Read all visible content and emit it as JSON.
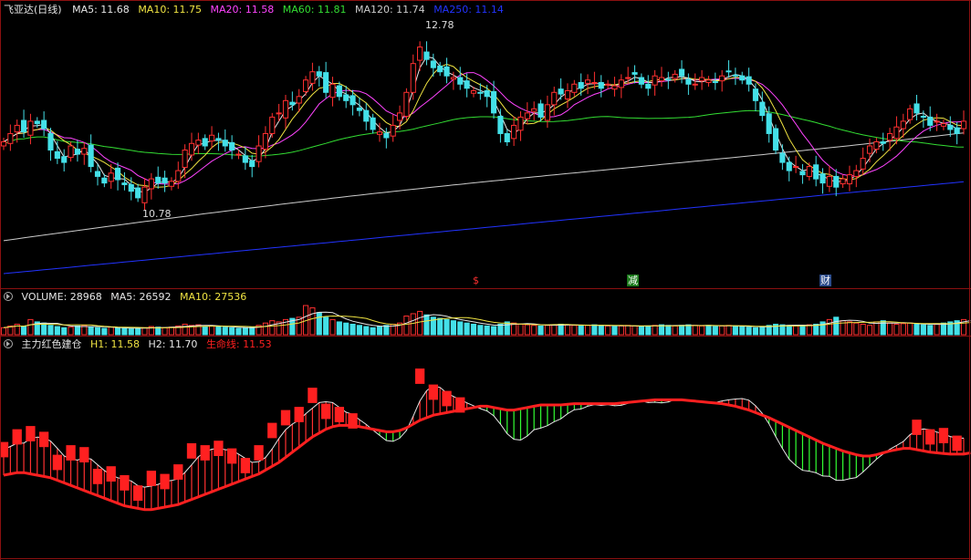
{
  "main_legend": {
    "title": "飞亚达(日线)",
    "items": [
      {
        "label": "MA5: 11.68",
        "color": "#e6e6e6"
      },
      {
        "label": "MA10: 11.75",
        "color": "#f0e442"
      },
      {
        "label": "MA20: 11.58",
        "color": "#ff44ff"
      },
      {
        "label": "MA60: 11.81",
        "color": "#33dd33"
      },
      {
        "label": "MA120: 11.74",
        "color": "#cccccc"
      },
      {
        "label": "MA250: 11.14",
        "color": "#2233ff"
      }
    ]
  },
  "volume_legend": {
    "items": [
      {
        "label": "VOLUME: 28968",
        "color": "#e6e6e6"
      },
      {
        "label": "MA5: 26592",
        "color": "#e6e6e6"
      },
      {
        "label": "MA10: 27536",
        "color": "#f0e442"
      }
    ]
  },
  "indicator_legend": {
    "items": [
      {
        "label": "主力红色建仓",
        "color": "#e6e6e6"
      },
      {
        "label": "H1: 11.58",
        "color": "#f0e442"
      },
      {
        "label": "H2: 11.70",
        "color": "#e6e6e6"
      },
      {
        "label": "生命线: 11.53",
        "color": "#ff2020"
      }
    ]
  },
  "events": [
    {
      "label": "$",
      "color": "#ff3030",
      "bg": "#000000"
    },
    {
      "label": "减",
      "color": "#ffffff",
      "bg": "#1a7a1a"
    },
    {
      "label": "财",
      "color": "#ffffff",
      "bg": "#2a4a8a"
    }
  ],
  "chart_data": {
    "type": "candlestick",
    "title": "飞亚达(日线)",
    "price_range": [
      10.0,
      13.1
    ],
    "annotations": [
      {
        "label": "12.78",
        "value": 12.78
      },
      {
        "label": "10.78",
        "value": 10.78
      }
    ],
    "closes": [
      11.6,
      11.7,
      11.8,
      11.72,
      11.85,
      11.82,
      11.76,
      11.5,
      11.4,
      11.35,
      11.55,
      11.45,
      11.52,
      11.3,
      11.18,
      11.1,
      11.22,
      11.14,
      11.08,
      11.0,
      10.92,
      11.05,
      11.15,
      11.1,
      11.1,
      11.12,
      11.25,
      11.5,
      11.58,
      11.62,
      11.55,
      11.68,
      11.62,
      11.55,
      11.5,
      11.45,
      11.35,
      11.3,
      11.55,
      11.7,
      11.9,
      11.95,
      12.1,
      12.05,
      12.15,
      12.35,
      12.45,
      12.4,
      12.2,
      12.3,
      12.15,
      12.1,
      12.05,
      11.98,
      11.85,
      11.75,
      11.72,
      11.65,
      11.8,
      11.95,
      12.2,
      12.55,
      12.75,
      12.6,
      12.5,
      12.45,
      12.4,
      12.38,
      12.3,
      12.25,
      12.22,
      12.2,
      12.15,
      11.95,
      11.7,
      11.6,
      11.8,
      11.9,
      11.95,
      12.0,
      11.9,
      12.05,
      12.2,
      12.18,
      12.22,
      12.3,
      12.25,
      12.35,
      12.32,
      12.25,
      12.3,
      12.28,
      12.35,
      12.38,
      12.42,
      12.3,
      12.25,
      12.4,
      12.38,
      12.35,
      12.42,
      12.4,
      12.3,
      12.3,
      12.38,
      12.35,
      12.32,
      12.4,
      12.45,
      12.4,
      12.35,
      12.3,
      12.1,
      11.92,
      11.7,
      11.5,
      11.35,
      11.25,
      11.3,
      11.2,
      11.3,
      11.15,
      11.1,
      11.18,
      11.05,
      11.15,
      11.2,
      11.25,
      11.4,
      11.55,
      11.6,
      11.58,
      11.7,
      11.78,
      11.85,
      12.0,
      11.95,
      11.9,
      11.8,
      11.85,
      11.82,
      11.75,
      11.7,
      11.85
    ],
    "volumes": [
      12000,
      15000,
      18000,
      14000,
      26000,
      22000,
      20000,
      16000,
      14000,
      12000,
      13000,
      15000,
      16000,
      14000,
      12000,
      11000,
      13000,
      12000,
      11000,
      10000,
      11000,
      12000,
      14000,
      13000,
      12000,
      13000,
      15000,
      18000,
      16000,
      17000,
      14000,
      15000,
      14000,
      13000,
      12000,
      11000,
      12000,
      13000,
      16000,
      20000,
      24000,
      22000,
      26000,
      28000,
      30000,
      50000,
      46000,
      38000,
      30000,
      26000,
      22000,
      20000,
      18000,
      16000,
      14000,
      12000,
      14000,
      16000,
      18000,
      20000,
      32000,
      36000,
      40000,
      34000,
      30000,
      28000,
      26000,
      24000,
      22000,
      20000,
      18000,
      16000,
      15000,
      14000,
      18000,
      22000,
      20000,
      18000,
      17000,
      16000,
      15000,
      16000,
      17000,
      18000,
      17000,
      16000,
      15000,
      16000,
      17000,
      16000,
      15000,
      14000,
      15000,
      16000,
      15000,
      14000,
      15000,
      16000,
      17000,
      16000,
      15000,
      16000,
      17000,
      16000,
      15000,
      16000,
      14000,
      15000,
      16000,
      15000,
      14000,
      13000,
      12000,
      14000,
      16000,
      18000,
      17000,
      16000,
      15000,
      16000,
      17000,
      18000,
      22000,
      26000,
      30000,
      24000,
      22000,
      20000,
      18000,
      16000,
      22000,
      24000,
      20000,
      18000,
      19000,
      20000,
      18000,
      17000,
      16000,
      18000,
      20000,
      22000,
      24000,
      26000,
      28000
    ],
    "lifeline": [
      11.2,
      11.22,
      11.24,
      11.24,
      11.22,
      11.2,
      11.18,
      11.16,
      11.12,
      11.08,
      11.04,
      11.0,
      10.96,
      10.92,
      10.88,
      10.84,
      10.8,
      10.76,
      10.72,
      10.7,
      10.68,
      10.66,
      10.66,
      10.68,
      10.7,
      10.72,
      10.74,
      10.78,
      10.82,
      10.86,
      10.9,
      10.94,
      10.98,
      11.02,
      11.06,
      11.1,
      11.14,
      11.18,
      11.22,
      11.28,
      11.34,
      11.4,
      11.48,
      11.56,
      11.64,
      11.72,
      11.8,
      11.86,
      11.92,
      11.96,
      11.98,
      11.98,
      11.98,
      11.96,
      11.94,
      11.92,
      11.9,
      11.88,
      11.88,
      11.9,
      11.94,
      12.0,
      12.06,
      12.1,
      12.14,
      12.16,
      12.18,
      12.2,
      12.22,
      12.24,
      12.26,
      12.28,
      12.28,
      12.26,
      12.24,
      12.22,
      12.22,
      12.24,
      12.26,
      12.28,
      12.3,
      12.3,
      12.3,
      12.3,
      12.31,
      12.32,
      12.32,
      12.32,
      12.32,
      12.32,
      12.32,
      12.32,
      12.33,
      12.34,
      12.35,
      12.36,
      12.37,
      12.38,
      12.38,
      12.38,
      12.38,
      12.38,
      12.37,
      12.36,
      12.35,
      12.34,
      12.33,
      12.32,
      12.3,
      12.28,
      12.25,
      12.22,
      12.18,
      12.14,
      12.1,
      12.05,
      12.0,
      11.95,
      11.9,
      11.85,
      11.8,
      11.75,
      11.7,
      11.66,
      11.62,
      11.58,
      11.55,
      11.52,
      11.5,
      11.5,
      11.52,
      11.55,
      11.58,
      11.6,
      11.62,
      11.62,
      11.6,
      11.58,
      11.56,
      11.55,
      11.54,
      11.53,
      11.53,
      11.53,
      11.55
    ]
  }
}
